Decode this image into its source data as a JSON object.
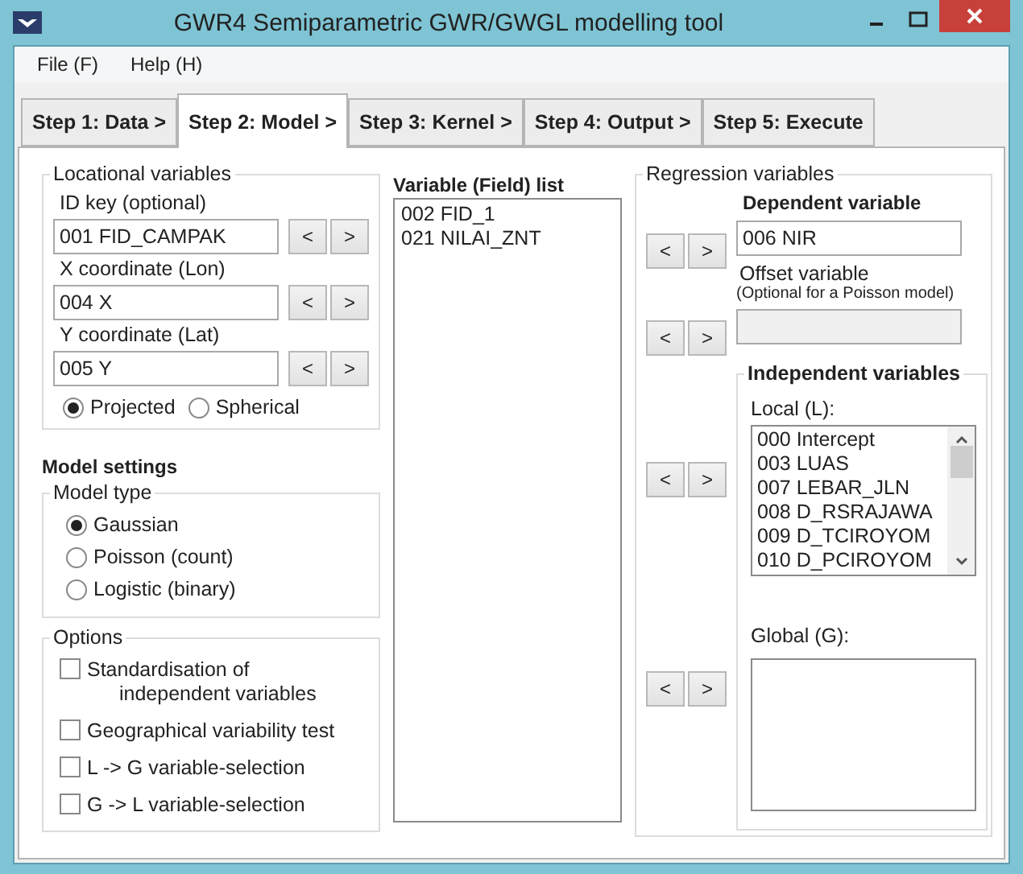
{
  "window": {
    "title": "GWR4  Semiparametric GWR/GWGL modelling tool"
  },
  "menu": [
    "File (F)",
    "Help (H)"
  ],
  "tabs": [
    {
      "label": "Step 1: Data >",
      "selected": false
    },
    {
      "label": "Step 2: Model >",
      "selected": true
    },
    {
      "label": "Step 3: Kernel >",
      "selected": false
    },
    {
      "label": "Step 4: Output >",
      "selected": false
    },
    {
      "label": "Step 5: Execute",
      "selected": false
    }
  ],
  "locational": {
    "title": "Locational variables",
    "fields": [
      {
        "label": "ID key (optional)",
        "value": "001 FID_CAMPAK",
        "buttons": [
          "<",
          ">"
        ]
      },
      {
        "label": "X coordinate (Lon)",
        "value": "004 X",
        "buttons": [
          "<",
          ">"
        ]
      },
      {
        "label": "Y coordinate (Lat)",
        "value": "005 Y",
        "buttons": [
          "<",
          ">"
        ]
      }
    ],
    "radios": [
      {
        "label": "Projected",
        "selected": true
      },
      {
        "label": "Spherical",
        "selected": false
      }
    ]
  },
  "model_settings": {
    "title": "Model settings",
    "model_type": {
      "title": "Model type",
      "options": [
        {
          "label": "Gaussian",
          "selected": true
        },
        {
          "label": "Poisson (count)",
          "selected": false
        },
        {
          "label": "Logistic (binary)",
          "selected": false
        }
      ]
    },
    "options": {
      "title": "Options",
      "items": [
        {
          "label": "Standardisation of",
          "label_2": "independent variables",
          "checked": false
        },
        {
          "label": "Geographical variability test",
          "checked": false
        },
        {
          "label": "L -> G variable-selection",
          "checked": false
        },
        {
          "label": "G -> L variable-selection",
          "checked": false
        }
      ]
    }
  },
  "field_list": {
    "title": "Variable (Field) list",
    "items": [
      "002 FID_1",
      "021 NILAI_ZNT"
    ]
  },
  "regression": {
    "title": "Regression variables",
    "dependent": {
      "title": "Dependent variable",
      "value": "006 NIR",
      "buttons": [
        "<",
        ">"
      ]
    },
    "offset": {
      "title": "Offset variable",
      "note": "(Optional for a Poisson model)",
      "buttons": [
        "<",
        ">"
      ]
    },
    "independent": {
      "title": "Independent variables",
      "local": {
        "label": "Local (L):",
        "items": [
          "000 Intercept",
          "003 LUAS",
          "007 LEBAR_JLN",
          "008 D_RSRAJAWA",
          "009 D_TCIROYOM",
          "010 D_PCIROYOM"
        ],
        "buttons": [
          "<",
          ">"
        ]
      },
      "global": {
        "label": "Global (G):",
        "buttons": [
          "<",
          ">"
        ]
      }
    }
  }
}
